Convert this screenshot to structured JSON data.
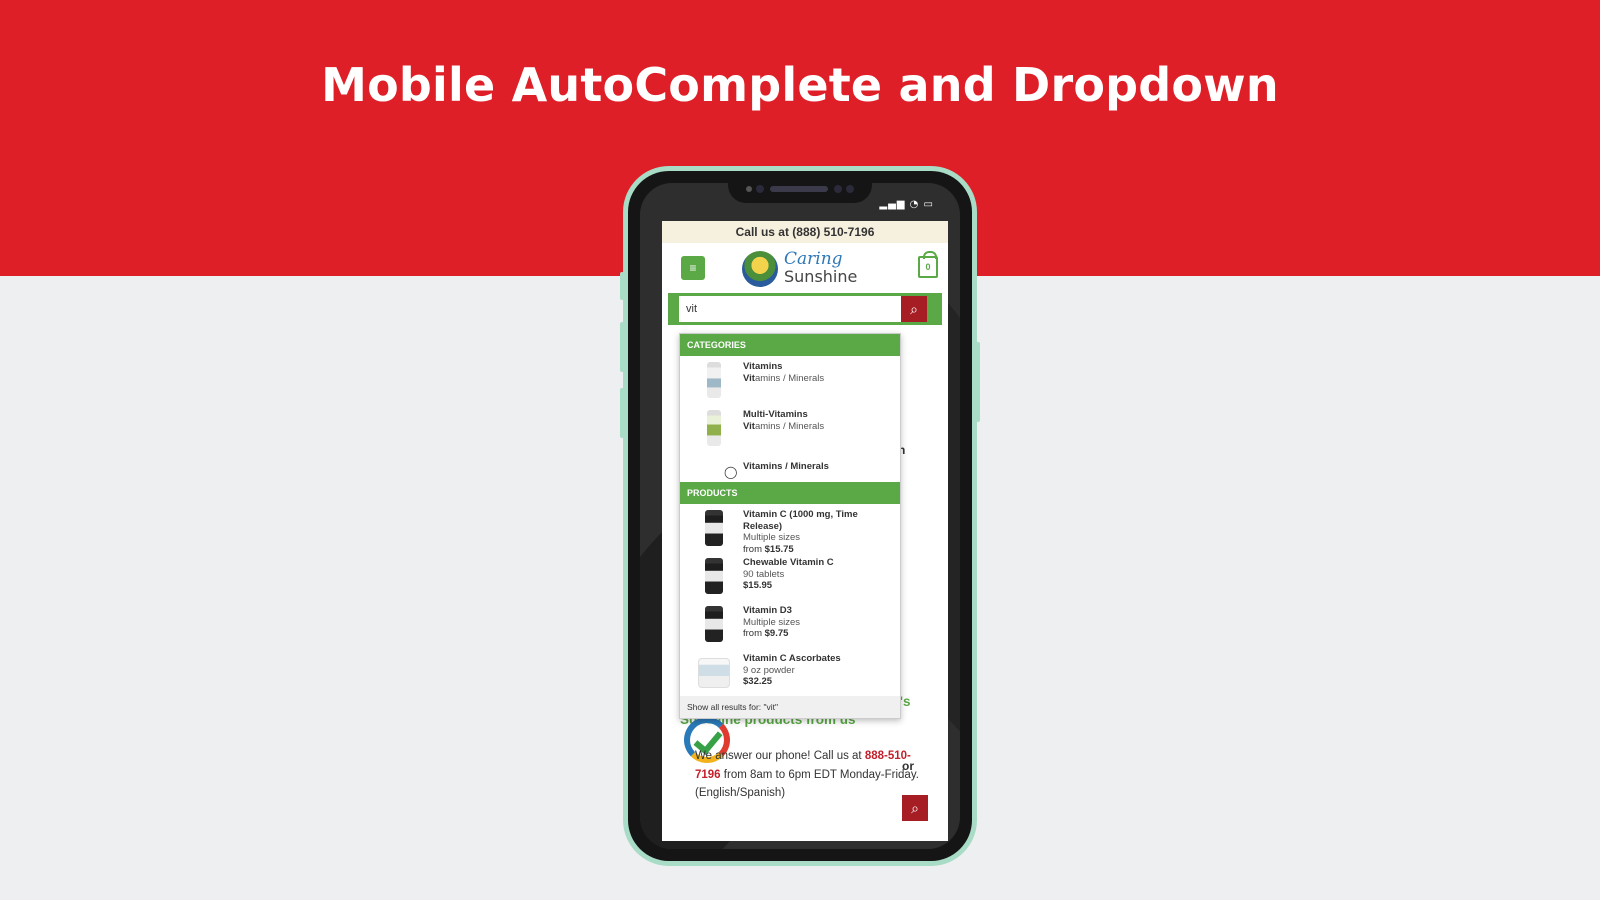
{
  "banner": {
    "title": "Mobile AutoComplete and Dropdown"
  },
  "phone_status": {
    "icons": "▂▄▆ ◔ ▭"
  },
  "site": {
    "call_bar": "Call us at (888) 510-7196",
    "logo": {
      "line1": "Caring",
      "line2": "Sunshine"
    },
    "menu_icon": "≡",
    "cart_count": "0",
    "search": {
      "value": "vit",
      "button_icon": "⌕"
    }
  },
  "dropdown": {
    "categories_header": "CATEGORIES",
    "categories": [
      {
        "title": "Vitamins",
        "sub_highlight": "Vit",
        "sub_rest": "amins / Minerals",
        "thumb": "light"
      },
      {
        "title": "Multi-Vitamins",
        "sub_highlight": "Vit",
        "sub_rest": "amins / Minerals",
        "thumb": "green"
      },
      {
        "title": "Vitamins / Minerals",
        "thumb": "tag-icon"
      }
    ],
    "products_header": "PRODUCTS",
    "products": [
      {
        "title": "Vitamin C (1000 mg, Time Release)",
        "sub": "Multiple sizes",
        "price_prefix": "from ",
        "price": "$15.75",
        "thumb": "dark"
      },
      {
        "title": "Chewable Vitamin C",
        "sub": "90 tablets",
        "price_prefix": "",
        "price": "$15.95",
        "thumb": "dark"
      },
      {
        "title": "Vitamin D3",
        "sub": "Multiple sizes",
        "price_prefix": "from ",
        "price": "$9.75",
        "thumb": "dark"
      },
      {
        "title": "Vitamin C Ascorbates",
        "sub": "9 oz powder",
        "price_prefix": "",
        "price": "$32.25",
        "thumb": "jar"
      }
    ],
    "show_all": "Show all results for: \"vit\""
  },
  "background_page": {
    "frag_right_1": "n",
    "frag_or": "or",
    "reasons_heading": "Four reasons to order your Nature's Sunshine products from us",
    "reason_1_prefix": "We answer our phone! Call us at ",
    "reason_1_phone": "888-510-7196",
    "reason_1_suffix": " from 8am to 6pm EDT Monday-Friday. (English/Spanish)"
  },
  "colors": {
    "banner_red": "#df1f27",
    "brand_green": "#5aa846",
    "button_red": "#a71d24",
    "phone_body": "#a8dcc6"
  }
}
